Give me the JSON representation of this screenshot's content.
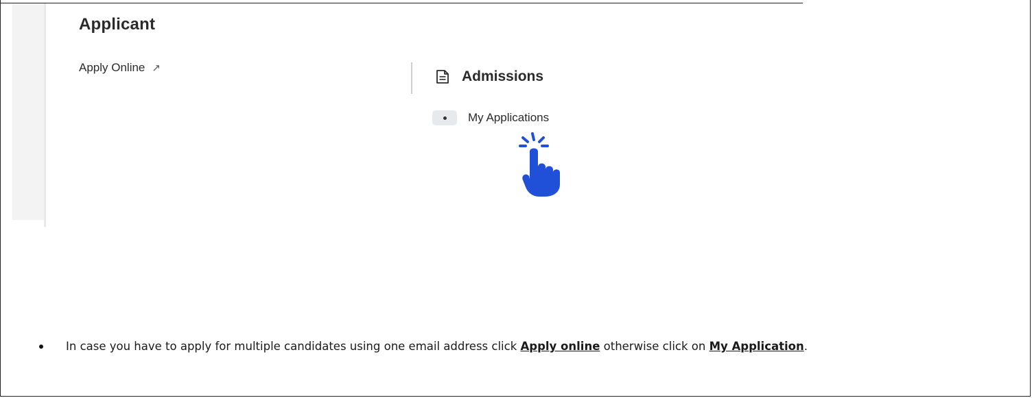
{
  "applicant_panel": {
    "title": "Applicant",
    "apply_online_label": "Apply Online",
    "apply_online_icon": "external-link-arrow-icon"
  },
  "admissions_panel": {
    "title": "Admissions",
    "title_icon": "document-icon",
    "items": [
      {
        "label": "My Applications",
        "icon": "bullet-dot-icon"
      }
    ],
    "pointer_icon": "tap-hand-icon",
    "pointer_color": "#2150d8"
  },
  "instruction": {
    "text_before": "In case you have to apply for multiple candidates using one email address click ",
    "link_apply_online": "Apply online",
    "text_middle": " otherwise click on ",
    "link_my_application": "My Application",
    "text_after": "."
  }
}
